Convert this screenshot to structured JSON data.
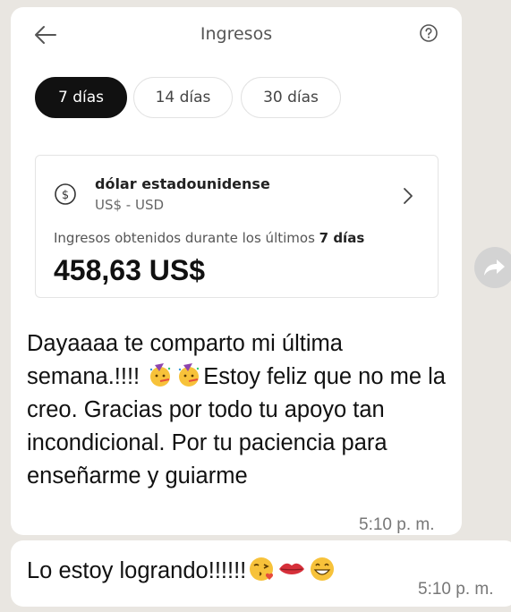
{
  "screenshot": {
    "title": "Ingresos",
    "back_icon": "arrow-left-icon",
    "help_icon": "question-circle-icon",
    "period_chips": [
      {
        "label": "7 días",
        "selected": true
      },
      {
        "label": "14 días",
        "selected": false
      },
      {
        "label": "30 días",
        "selected": false
      }
    ],
    "currency_card": {
      "icon": "dollar-circle-icon",
      "name": "dólar estadounidense",
      "code": "US$ - USD",
      "earnings_label_prefix": "Ingresos obtenidos durante los últimos ",
      "earnings_label_period": "7 días",
      "amount": "458,63 US$"
    }
  },
  "message1": {
    "text_part1": "Dayaaaa te comparto mi última semana.!!!! ",
    "emojis_inline": [
      "party-face-emoji",
      "party-face-emoji"
    ],
    "text_part2": "Estoy feliz que no me la creo. Gracias por todo tu apoyo tan incondicional. Por tu paciencia para enseñarme y guiarme",
    "time": "5:10 p. m."
  },
  "forward_icon": "forward-arrow-icon",
  "message2": {
    "text": "Lo estoy logrando!!!!!!",
    "emojis": [
      "kiss-face-emoji",
      "lips-emoji",
      "grinning-face-emoji"
    ],
    "time": "5:10 p. m."
  },
  "colors": {
    "chat_background": "#e9e6e1",
    "bubble": "#ffffff",
    "active_chip": "#111111"
  }
}
